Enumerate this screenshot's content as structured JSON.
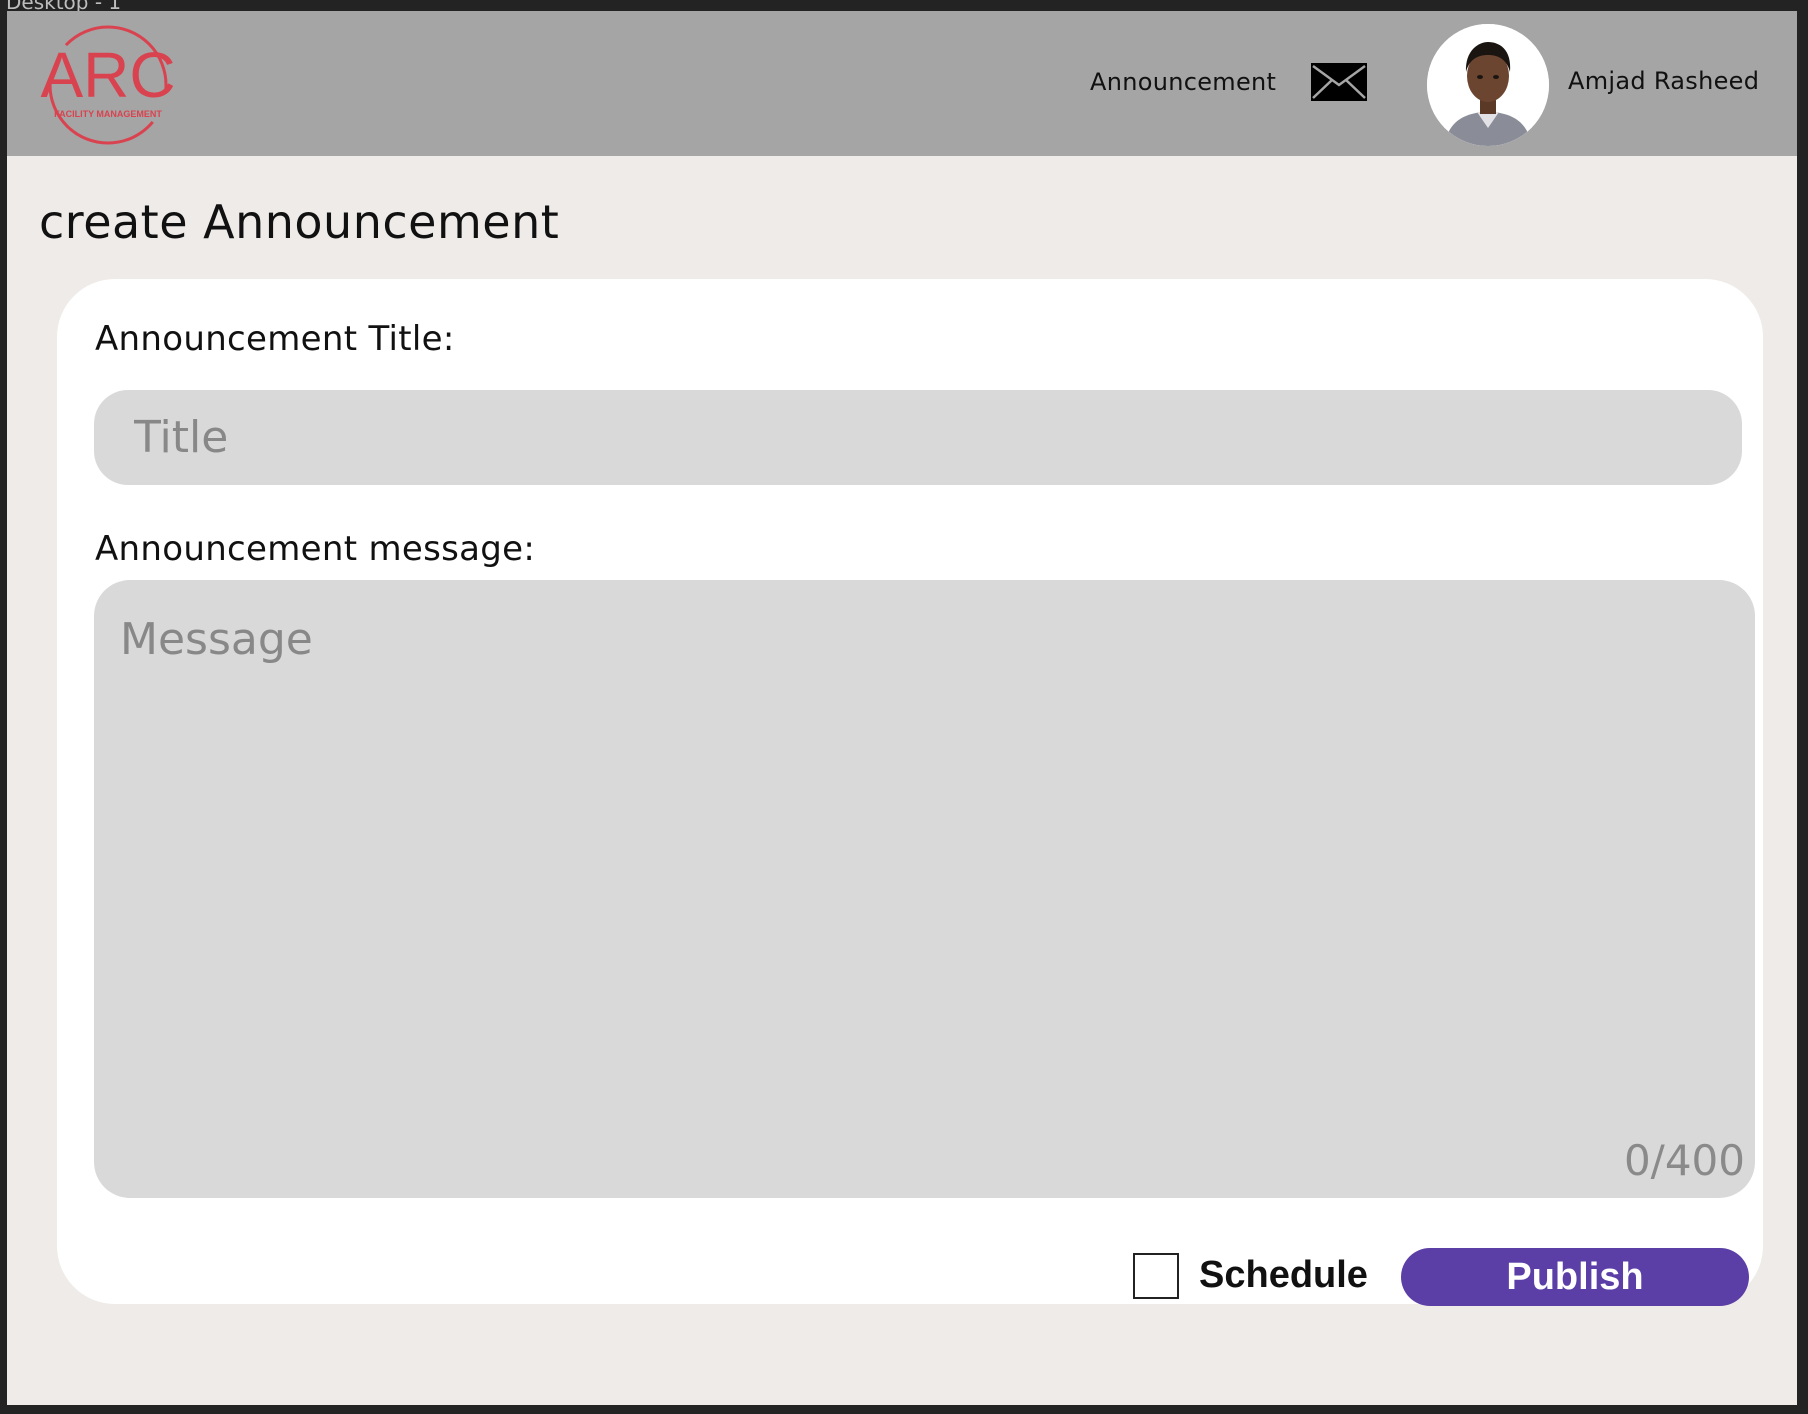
{
  "frame": {
    "label": "Desktop - 1"
  },
  "header": {
    "logo": {
      "main_text": "ARC",
      "sub_text": "FACILITY MANAGEMENT",
      "color": "#d9434f"
    },
    "nav": {
      "announcement_label": "Announcement",
      "mail_icon": "mail-icon"
    },
    "user": {
      "name": "Amjad Rasheed",
      "avatar_icon": "user-avatar"
    },
    "background": "#a5a5a5"
  },
  "page": {
    "title": "create Announcement",
    "background": "#efebe9"
  },
  "form": {
    "title_label": "Announcement Title:",
    "title_placeholder": "Title",
    "title_value": "",
    "message_label": "Announcement message:",
    "message_placeholder": "Message",
    "message_value": "",
    "char_count": "0/400",
    "schedule_label": "Schedule",
    "schedule_checked": false,
    "publish_label": "Publish",
    "publish_color": "#5b3fa6",
    "input_background": "#d9d9d9"
  }
}
